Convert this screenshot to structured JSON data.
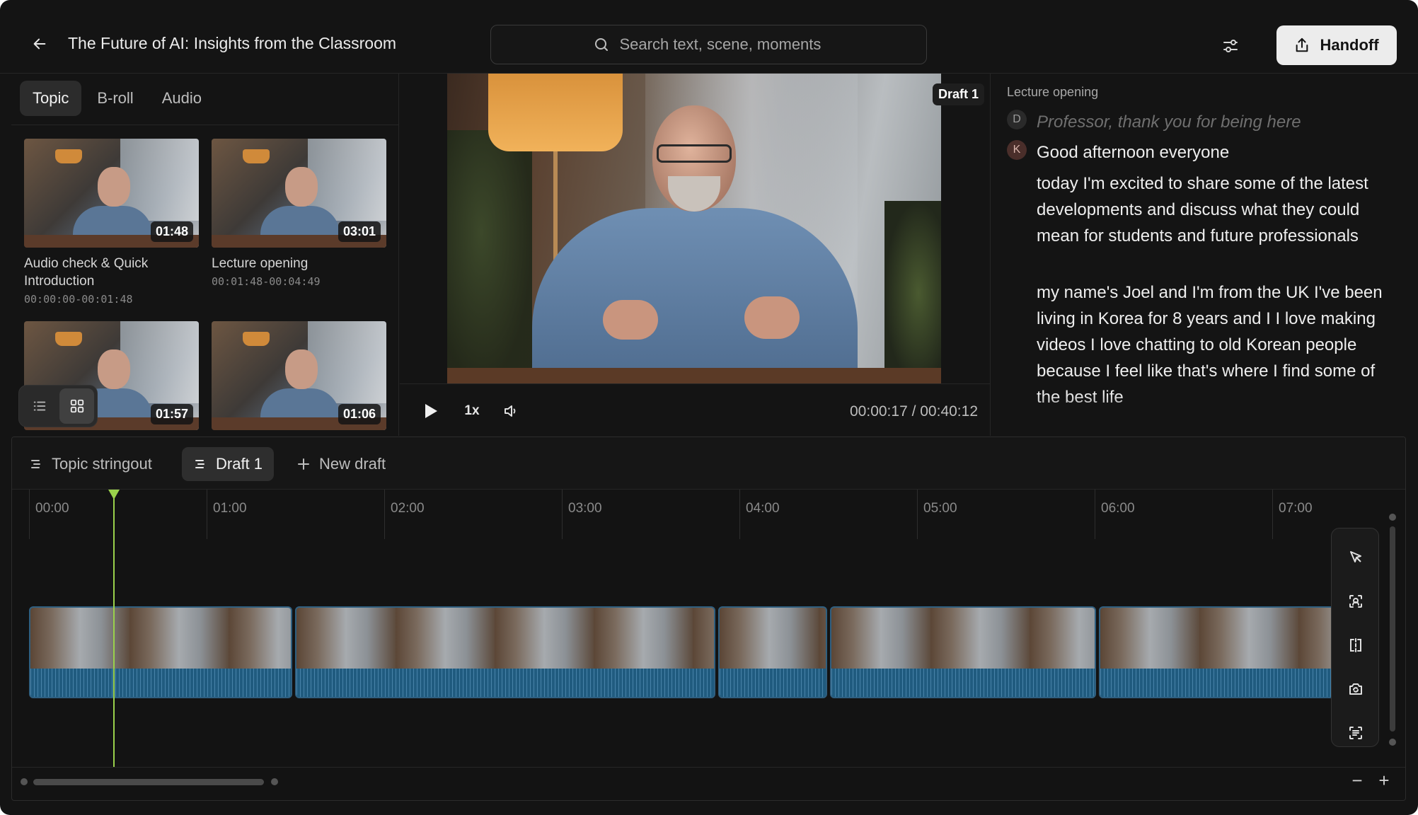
{
  "header": {
    "back_icon": "arrow-left-icon",
    "title": "The Future of AI: Insights from the Classroom",
    "search_placeholder": "Search text, scene, moments",
    "filter_icon": "sliders-icon",
    "handoff_label": "Handoff",
    "handoff_icon": "share-upload-icon"
  },
  "left_panel": {
    "tabs": [
      {
        "label": "Topic",
        "active": true
      },
      {
        "label": "B-roll",
        "active": false
      },
      {
        "label": "Audio",
        "active": false
      }
    ],
    "clips": [
      {
        "duration": "01:48",
        "title": "Audio check & Quick Introduction",
        "timerange": "00:00:00-00:01:48"
      },
      {
        "duration": "03:01",
        "title": "Lecture opening",
        "timerange": "00:01:48-00:04:49"
      },
      {
        "duration": "01:57",
        "title": "",
        "timerange": ""
      },
      {
        "duration": "01:06",
        "title": "",
        "timerange": ""
      }
    ],
    "view_toggle": {
      "list_icon": "list-icon",
      "grid_icon": "grid-icon",
      "active": "grid"
    }
  },
  "player": {
    "draft_badge": "Draft 1",
    "speed": "1x",
    "timecode": "00:00:17 / 00:40:12",
    "play_icon": "play-icon",
    "volume_icon": "volume-icon"
  },
  "transcript": {
    "section": "Lecture opening",
    "lines": [
      {
        "speaker": "D",
        "text": "Professor, thank you for being here",
        "muted": true
      },
      {
        "speaker": "K",
        "text": "Good afternoon everyone",
        "muted": false
      }
    ],
    "paragraphs": [
      "today I'm excited to share some of the latest developments and discuss what they could mean for students and future professionals",
      "my name's Joel and I'm from the UK I've been living in Korea for 8 years and I I love making videos I love chatting to old Korean people because I feel like that's where I find some of the best life"
    ]
  },
  "timeline": {
    "draft_tabs": [
      {
        "label": "Topic stringout",
        "active": false,
        "icon": "stringout-icon"
      },
      {
        "label": "Draft 1",
        "active": true,
        "icon": "stringout-icon"
      },
      {
        "label": "New draft",
        "active": false,
        "icon": "plus-icon"
      }
    ],
    "ruler": [
      "00:00",
      "01:00",
      "02:00",
      "03:00",
      "04:00",
      "05:00",
      "06:00",
      "07:00"
    ],
    "tools": [
      "cursor-icon",
      "scan-face-icon",
      "split-icon",
      "camera-swap-icon",
      "scan-text-icon"
    ],
    "zoom_out": "−",
    "zoom_in": "+"
  },
  "colors": {
    "background": "#141414",
    "accent_playhead": "#9ad14b",
    "clip_blue": "#1f5a7c",
    "handoff_bg": "#ececec"
  }
}
